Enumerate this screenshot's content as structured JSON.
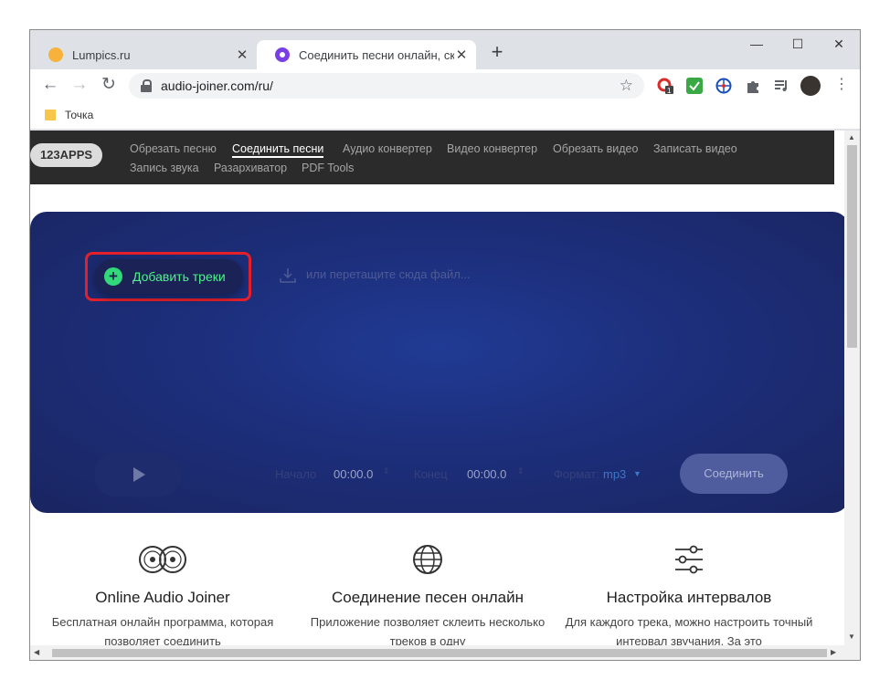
{
  "browser": {
    "tabs": [
      {
        "title": "Lumpics.ru",
        "icon": "lumpics-favicon"
      },
      {
        "title": "Соединить песни онлайн, склеи",
        "icon": "123apps-favicon"
      }
    ],
    "url": "audio-joiner.com/ru/",
    "bookmark": "Точка",
    "extension_badge": "1"
  },
  "site": {
    "logo": "123APPS",
    "nav": [
      "Обрезать песню",
      "Соединить песни",
      "Аудио конвертер",
      "Видео конвертер",
      "Обрезать видео",
      "Записать видео",
      "Запись звука",
      "Разархиватор",
      "PDF Tools"
    ],
    "nav_active": "Соединить песни"
  },
  "editor": {
    "add_button": "Добавить треки",
    "drop_hint": "или перетащите сюда файл...",
    "start_label": "Начало",
    "start_value": "00:00.0",
    "end_label": "Конец",
    "end_value": "00:00.0",
    "format_label": "Формат:",
    "format_value": "mp3",
    "join_button": "Соединить"
  },
  "features": [
    {
      "title": "Online Audio Joiner",
      "text": "Бесплатная онлайн программа, которая позволяет соединить",
      "icon": "vinyl-icon"
    },
    {
      "title": "Соединение песен онлайн",
      "text": "Приложение позволяет склеить несколько треков в одну",
      "icon": "globe-icon"
    },
    {
      "title": "Настройка интервалов",
      "text": "Для каждого трека, можно настроить точный интервал звучания. За это",
      "icon": "sliders-icon"
    }
  ],
  "colors": {
    "hero_bg": "#1d2f7d",
    "add_text": "#4df38a",
    "highlight": "#e4202a",
    "nav_bg": "#2b2b2b"
  }
}
